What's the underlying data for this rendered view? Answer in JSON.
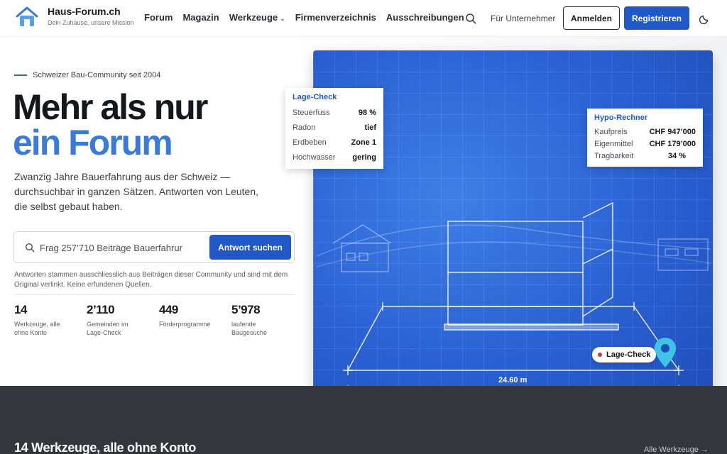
{
  "header": {
    "logo_title": "Haus-Forum.ch",
    "logo_tagline": "Dein Zuhause, unsere Mission",
    "nav": [
      {
        "label": "Forum"
      },
      {
        "label": "Magazin"
      },
      {
        "label": "Werkzeuge"
      },
      {
        "label": "Firmenverzeichnis"
      },
      {
        "label": "Ausschreibungen"
      }
    ],
    "fuer_unternehmer": "Für Unternehmer",
    "login_label": "Anmelden",
    "register_label": "Registrieren"
  },
  "hero": {
    "eyebrow": "Schweizer Bau-Community seit 2004",
    "headline_1": "Mehr als nur",
    "headline_2": "ein Forum",
    "lead": "Zwanzig Jahre Bauerfahrung aus der Schweiz — durchsuchbar in ganzen Sätzen. Antworten von Leuten, die selbst gebaut haben.",
    "search_placeholder": "Frag 257’710 Beiträge Bauerfahrur",
    "search_button": "Antwort suchen",
    "disclaimer": "Antworten stammen ausschliesslich aus Beiträgen dieser Community und sind mit dem Original verlinkt. Keine erfundenen Quellen.",
    "stats": [
      {
        "value": "14",
        "label": "Werkzeuge, alle ohne Konto"
      },
      {
        "value": "2’110",
        "label": "Gemeinden im Lage-Check"
      },
      {
        "value": "449",
        "label": "Förderprogramme"
      },
      {
        "value": "5’978",
        "label": "laufende Baugesuche"
      }
    ]
  },
  "lage_check": {
    "title": "Lage-Check",
    "rows": [
      {
        "key": "Steuerfuss",
        "value": "98 %"
      },
      {
        "key": "Radon",
        "value": "tief"
      },
      {
        "key": "Erdbeben",
        "value": "Zone 1"
      },
      {
        "key": "Hochwasser",
        "value": "gering"
      }
    ]
  },
  "hypo_rechner": {
    "title": "Hypo-Rechner",
    "rows": [
      {
        "key": "Kaufpreis",
        "value": "CHF 947’000"
      },
      {
        "key": "Eigenmittel",
        "value": "CHF 179’000"
      },
      {
        "key": "Tragbarkeit",
        "value": "34 %"
      }
    ]
  },
  "blueprint": {
    "pin_label": "Lage-Check",
    "dimension": "24.60 m",
    "accent": "#2a5fd1",
    "pin_color": "#3fc3e6"
  },
  "tools_section": {
    "title": "14 Werkzeuge, alle ohne Konto",
    "link": "Alle Werkzeuge →"
  },
  "colors": {
    "primary": "#2158c7",
    "headline_accent": "#3a7ad9",
    "dark_section": "#33363d"
  }
}
